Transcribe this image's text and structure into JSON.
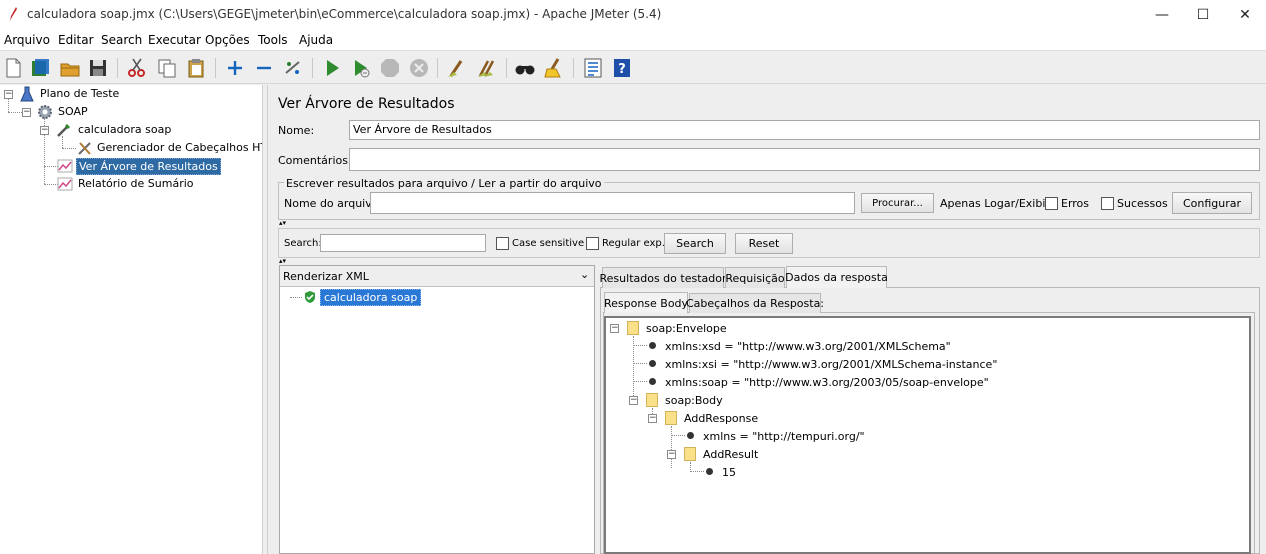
{
  "window": {
    "title": "calculadora soap.jmx (C:\\Users\\GEGE\\jmeter\\bin\\eCommerce\\calculadora soap.jmx) - Apache JMeter (5.4)",
    "min_glyph": "—",
    "max_glyph": "☐",
    "close_glyph": "✕"
  },
  "menu": [
    "Arquivo",
    "Editar",
    "Search",
    "Executar",
    "Opções",
    "Tools",
    "Ajuda"
  ],
  "toolbar_icons": [
    "new-icon",
    "templates-icon",
    "open-icon",
    "save-icon",
    "cut-icon",
    "copy-icon",
    "paste-icon",
    "expand-icon",
    "collapse-icon",
    "toggle-icon",
    "start-icon",
    "start-no-pause-icon",
    "stop-icon",
    "shutdown-icon",
    "clear-icon",
    "clear-all-icon",
    "search-icon",
    "reset-search-icon",
    "function-helper-icon",
    "help-icon"
  ],
  "tree": {
    "plan": "Plano de Teste",
    "thread_group": "SOAP",
    "sampler": "calculadora soap",
    "header_manager": "Gerenciador de Cabeçalhos HTTP",
    "view_results": "Ver Árvore de Resultados",
    "summary": "Relatório de Sumário"
  },
  "panel": {
    "title": "Ver Árvore de Resultados",
    "name_label": "Nome:",
    "name_value": "Ver Árvore de Resultados",
    "comments_label": "Comentários:",
    "comments_value": "",
    "file_group_title": "Escrever resultados para arquivo / Ler a partir do arquivo",
    "filename_label": "Nome do arquivo",
    "filename_value": "",
    "browse_button": "Procurar...",
    "log_only_label": "Apenas Logar/Exibir",
    "errors_label": "Erros",
    "successes_label": "Sucessos",
    "configure_button": "Configurar"
  },
  "search": {
    "label": "Search:",
    "value": "",
    "case_sensitive": "Case sensitive",
    "regular_exp": "Regular exp.",
    "search_button": "Search",
    "reset_button": "Reset"
  },
  "results": {
    "renderer": "Renderizar XML",
    "sample": "calculadora soap"
  },
  "tabs": {
    "main": [
      "Resultados do testador",
      "Requisição",
      "Dados da resposta"
    ],
    "active_main": "Dados da resposta",
    "sub": [
      "Response Body",
      "Cabeçalhos da Resposta:"
    ],
    "active_sub": "Response Body"
  },
  "xml": {
    "envelope": "soap:Envelope",
    "xsd": "xmlns:xsd = \"http://www.w3.org/2001/XMLSchema\"",
    "xsi": "xmlns:xsi = \"http://www.w3.org/2001/XMLSchema-instance\"",
    "soap": "xmlns:soap = \"http://www.w3.org/2003/05/soap-envelope\"",
    "body": "soap:Body",
    "add_response": "AddResponse",
    "xmlns": "xmlns = \"http://tempuri.org/\"",
    "add_result": "AddResult",
    "value": "15"
  },
  "colors": {
    "selection": "#2e6ba4",
    "selection_text": "#ffffff",
    "panel_bg": "#eeeeee",
    "folder": "#fbe08a"
  }
}
